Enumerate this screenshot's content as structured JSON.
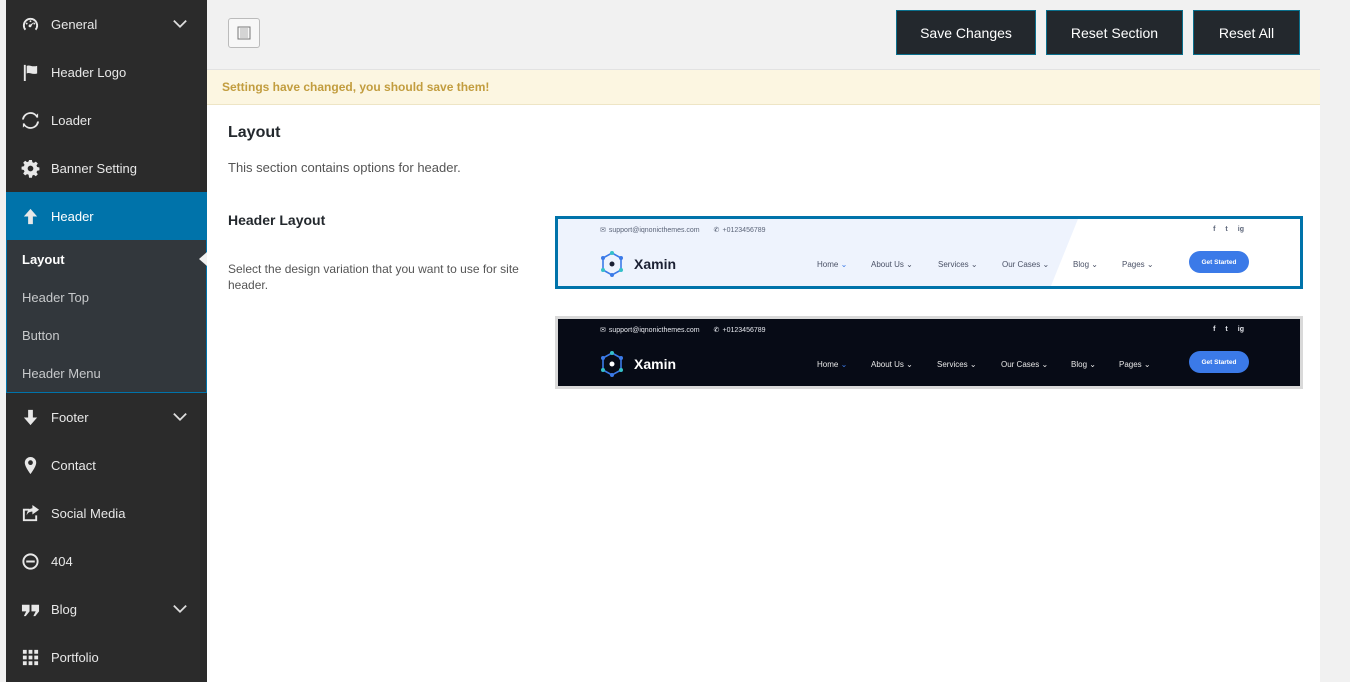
{
  "sidebar": {
    "items": [
      {
        "label": "General",
        "icon": "dashboard-icon",
        "has_chevron": true
      },
      {
        "label": "Header Logo",
        "icon": "flag-icon",
        "has_chevron": false
      },
      {
        "label": "Loader",
        "icon": "refresh-icon",
        "has_chevron": false
      },
      {
        "label": "Banner Setting",
        "icon": "gear-icon",
        "has_chevron": false
      },
      {
        "label": "Header",
        "icon": "arrow-up-icon",
        "has_chevron": false,
        "active": true
      },
      {
        "label": "Footer",
        "icon": "arrow-down-icon",
        "has_chevron": true
      },
      {
        "label": "Contact",
        "icon": "location-pin-icon",
        "has_chevron": false
      },
      {
        "label": "Social Media",
        "icon": "share-icon",
        "has_chevron": false
      },
      {
        "label": "404",
        "icon": "minus-circle-icon",
        "has_chevron": false
      },
      {
        "label": "Blog",
        "icon": "quote-icon",
        "has_chevron": true
      },
      {
        "label": "Portfolio",
        "icon": "grid-icon",
        "has_chevron": false
      }
    ],
    "submenu": [
      {
        "label": "Layout",
        "current": true
      },
      {
        "label": "Header Top"
      },
      {
        "label": "Button"
      },
      {
        "label": "Header Menu"
      }
    ]
  },
  "toolbar": {
    "save_label": "Save Changes",
    "reset_section_label": "Reset Section",
    "reset_all_label": "Reset All"
  },
  "notice": "Settings have changed, you should save them!",
  "section": {
    "title": "Layout",
    "description": "This section contains options for header."
  },
  "field": {
    "title": "Header Layout",
    "description": "Select the design variation that you want to use for site header."
  },
  "preview": {
    "email": "support@iqnonicthemes.com",
    "phone": "+0123456789",
    "brand": "Xamin",
    "nav": [
      "Home",
      "About Us",
      "Services",
      "Our Cases",
      "Blog",
      "Pages"
    ],
    "cta": "Get Started",
    "social": [
      "f",
      "t",
      "ig"
    ]
  },
  "colors": {
    "sidebar_bg": "#2b2b2b",
    "active_bg": "#0073aa",
    "button_bg": "#23282d",
    "notice_text": "#c29d3f",
    "notice_bg": "#fcf6e1",
    "cta": "#3b7ae8"
  }
}
